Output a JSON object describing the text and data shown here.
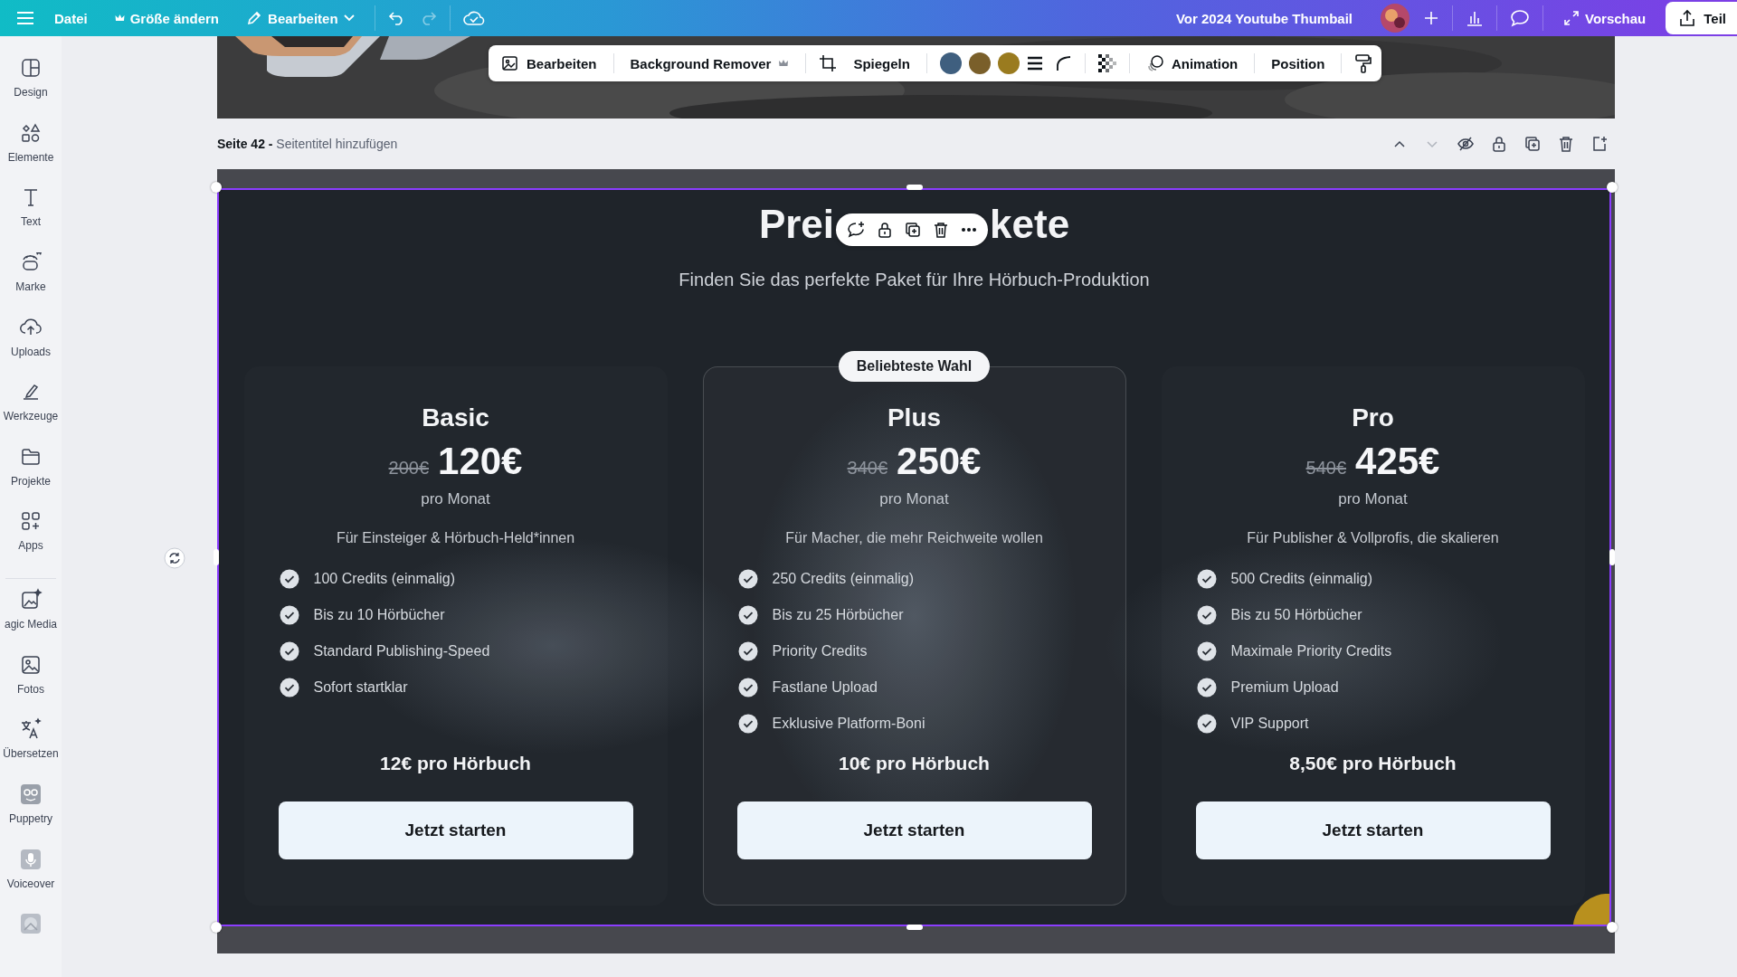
{
  "topbar": {
    "menu": [
      {
        "kind": "plain",
        "label": "Datei"
      },
      {
        "kind": "crown",
        "label": "Größe ändern"
      },
      {
        "kind": "edit",
        "label": "Bearbeiten"
      }
    ],
    "document_title": "Vor 2024 Youtube Thumbail",
    "preview_button": "Vorschau",
    "share_button": "Teil"
  },
  "sidebar": {
    "items": [
      {
        "kind": "design",
        "label": "Design"
      },
      {
        "kind": "elements",
        "label": "Elemente"
      },
      {
        "kind": "text",
        "label": "Text"
      },
      {
        "kind": "brand",
        "label": "Marke"
      },
      {
        "kind": "uploads",
        "label": "Uploads"
      },
      {
        "kind": "tools",
        "label": "Werkzeuge"
      },
      {
        "kind": "projects",
        "label": "Projekte"
      },
      {
        "kind": "apps",
        "label": "Apps"
      },
      {
        "kind": "magic",
        "label": "agic Media"
      },
      {
        "kind": "photos",
        "label": "Fotos"
      },
      {
        "kind": "translate",
        "label": "Übersetzen"
      },
      {
        "kind": "puppetry",
        "label": "Puppetry"
      },
      {
        "kind": "voiceover",
        "label": "Voiceover"
      },
      {
        "kind": "thumbnail"
      }
    ]
  },
  "image_toolbar": {
    "edit": "Bearbeiten",
    "bg_remover": "Background Remover",
    "flip": "Spiegeln",
    "colors": [
      {
        "color": "#3f5f7f"
      },
      {
        "color": "#7a5f2a"
      },
      {
        "color": "#9a7b1f"
      }
    ],
    "animation": "Animation",
    "position": "Position"
  },
  "page_header": {
    "page_label": "Seite 42 -",
    "title_placeholder": "Seitentitel hinzufügen"
  },
  "design": {
    "title_parts": [
      "Prei",
      "kete"
    ],
    "subtitle": "Finden Sie das perfekte Paket für Ihre Hörbuch-Produktion",
    "plans": [
      {
        "name": "Basic",
        "old_price": "200€",
        "price": "120€",
        "period": "pro Monat",
        "description": "Für Einsteiger & Hörbuch-Held*innen",
        "features": [
          "100 Credits (einmalig)",
          "Bis zu 10 Hörbücher",
          "Standard Publishing-Speed",
          "Sofort startklar"
        ],
        "per_unit": "12€ pro Hörbuch",
        "button": "Jetzt starten",
        "highlighted": false
      },
      {
        "name": "Plus",
        "badge": "Beliebteste Wahl",
        "old_price": "340€",
        "price": "250€",
        "period": "pro Monat",
        "description": "Für Macher, die mehr Reichweite wollen",
        "features": [
          "250 Credits (einmalig)",
          "Bis zu 25 Hörbücher",
          "Priority Credits",
          "Fastlane Upload",
          "Exklusive Platform-Boni"
        ],
        "per_unit": "10€ pro Hörbuch",
        "button": "Jetzt starten",
        "highlighted": true
      },
      {
        "name": "Pro",
        "old_price": "540€",
        "price": "425€",
        "period": "pro Monat",
        "description": "Für Publisher & Vollprofis, die skalieren",
        "features": [
          "500 Credits (einmalig)",
          "Bis zu 50 Hörbücher",
          "Maximale Priority Credits",
          "Premium Upload",
          "VIP Support"
        ],
        "per_unit": "8,50€ pro Hörbuch",
        "button": "Jetzt starten",
        "highlighted": false
      }
    ]
  }
}
